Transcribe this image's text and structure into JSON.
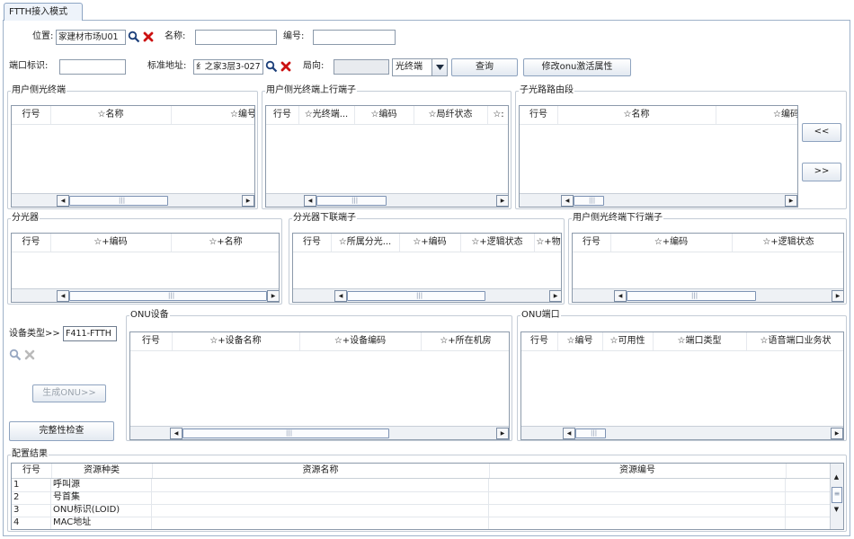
{
  "tab": {
    "label": "FTTH接入模式"
  },
  "row1": {
    "location_label": "位置:",
    "location_value": "家建材市场U01",
    "name_label": "名称:",
    "name_value": "",
    "code_label": "编号:",
    "code_value": ""
  },
  "row2": {
    "port_label": "端口标识:",
    "port_value": "",
    "address_label": "标准地址:",
    "address_value": "纟之家3层3-027",
    "direction_label": "局向:",
    "direction_value": "",
    "type_select": "光终端",
    "query_button": "查询",
    "modify_button": "修改onu激活属性"
  },
  "panels": {
    "user_terminal": {
      "title": "用户侧光终端",
      "headers": [
        "行号",
        "☆名称",
        "☆编号"
      ]
    },
    "user_terminal_up": {
      "title": "用户侧光终端上行端子",
      "headers": [
        "行号",
        "☆光终端...",
        "☆编码",
        "☆局纤状态",
        "☆:"
      ]
    },
    "sub_route": {
      "title": "子光路路由段",
      "headers": [
        "行号",
        "☆名称",
        "☆编码"
      ]
    },
    "splitter": {
      "title": "分光器",
      "headers": [
        "行号",
        "☆+编码",
        "☆+名称"
      ]
    },
    "splitter_down": {
      "title": "分光器下联端子",
      "headers": [
        "行号",
        "☆所属分光...",
        "☆+编码",
        "☆+逻辑状态",
        "☆+物"
      ]
    },
    "user_terminal_down": {
      "title": "用户侧光终端下行端子",
      "headers": [
        "行号",
        "☆+编码",
        "☆+逻辑状态"
      ]
    },
    "onu_device": {
      "title": "ONU设备",
      "headers": [
        "行号",
        "☆+设备名称",
        "☆+设备编码",
        "☆+所在机房"
      ]
    },
    "onu_port": {
      "title": "ONU端口",
      "headers": [
        "行号",
        "☆编号",
        "☆可用性",
        "☆端口类型",
        "☆语音端口业务状"
      ]
    }
  },
  "nav": {
    "left": "<<",
    "right": ">>"
  },
  "device": {
    "type_label": "设备类型>>",
    "type_value": "F411-FTTH",
    "generate_button": "生成ONU>>",
    "check_button": "完整性检查"
  },
  "result": {
    "title": "配置结果",
    "headers": [
      "行号",
      "资源种类",
      "资源名称",
      "资源编号"
    ],
    "rows": [
      [
        "1",
        "呼叫源",
        "",
        ""
      ],
      [
        "2",
        "号首集",
        "",
        ""
      ],
      [
        "3",
        "ONU标识(LOID)",
        "",
        ""
      ],
      [
        "4",
        "MAC地址",
        "",
        ""
      ]
    ]
  },
  "colors": {
    "accent": "#2f5a9e",
    "delete": "#cc1111",
    "border": "#8c9aab"
  }
}
